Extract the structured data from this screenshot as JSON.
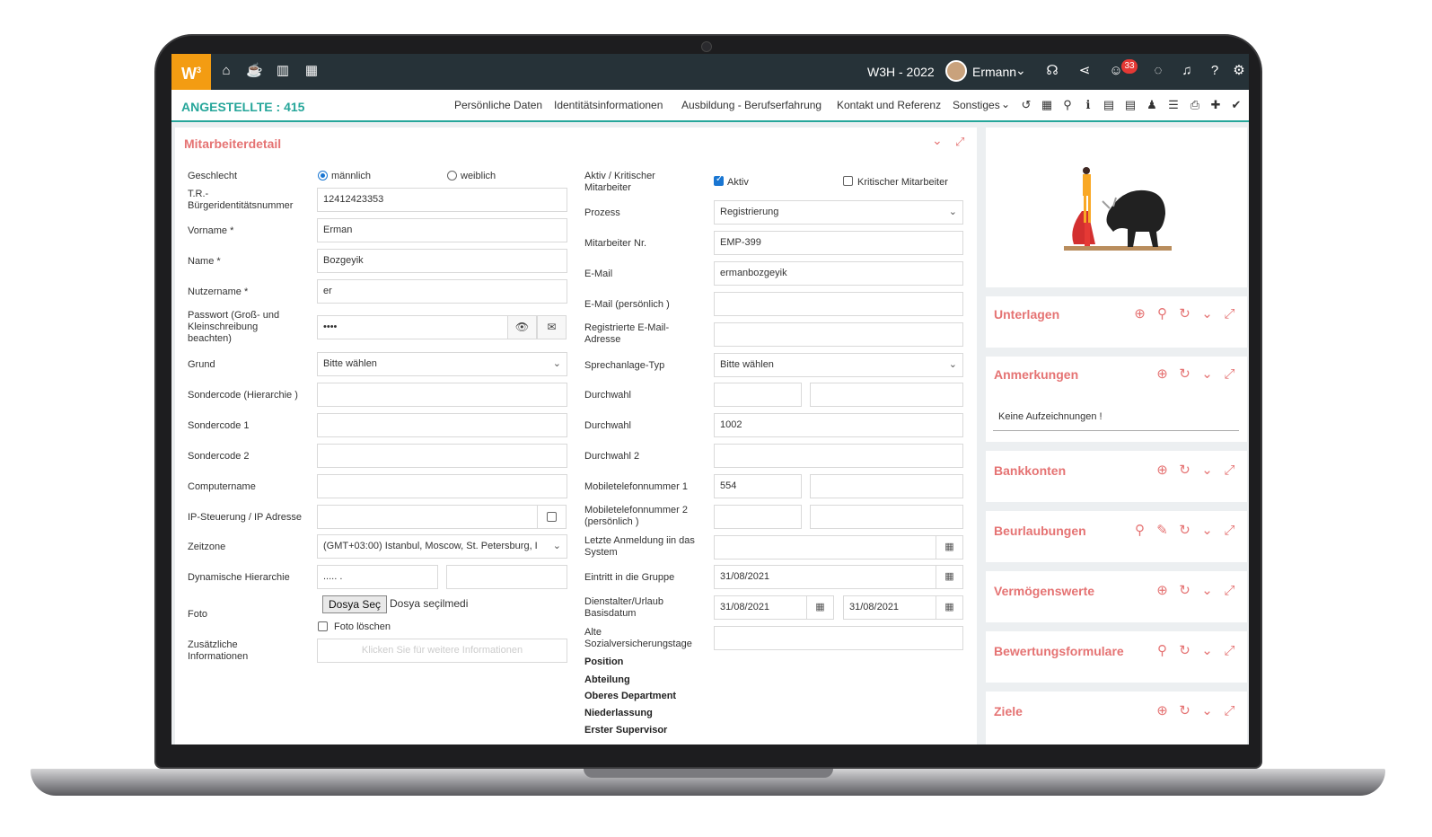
{
  "header": {
    "logo": "W",
    "logo_sup": "3",
    "nav_icons": [
      "home-icon",
      "coffee-icon",
      "bar-chart-icon",
      "calendar-icon"
    ],
    "company": "W3H - 2022",
    "user": "Ermann",
    "user_chevron": "⌄",
    "notification_count": "33",
    "right_icons": [
      "headset-icon",
      "share-icon",
      "smiley-icon",
      "chat-icon",
      "bell-icon",
      "help-icon",
      "gear-icon"
    ]
  },
  "subbar": {
    "title": "ANGESTELLTE : 415",
    "tabs": [
      "Persönliche Daten",
      "Identitätsinformationen",
      "Ausbildung - Berufserfahrung",
      "Kontakt und Referenz",
      "Sonstiges"
    ],
    "tool_icons": [
      "history-icon",
      "table-icon",
      "search-icon",
      "info-icon",
      "archive-icon",
      "archive-2-icon",
      "bell-icon",
      "list-icon",
      "print-icon",
      "plus-icon",
      "check-icon"
    ]
  },
  "detail": {
    "title": "Mitarbeiterdetail",
    "left": {
      "gender_label": "Geschlecht",
      "gender_male": "männlich",
      "gender_female": "weiblich",
      "tc_label": "T.R.-Bürgeridentitätsnummer",
      "tc_value": "12412423353",
      "firstname_label": "Vorname *",
      "firstname_value": "Erman",
      "name_label": "Name *",
      "name_value": "Bozgeyik",
      "username_label": "Nutzername *",
      "username_value": "er",
      "password_label": "Passwort (Groß- und Kleinschreibung beachten)",
      "password_value": "••••",
      "reason_label": "Grund",
      "reason_value": "Bitte wählen",
      "special_hier_label": "Sondercode (Hierarchie )",
      "special1_label": "Sondercode 1",
      "special2_label": "Sondercode 2",
      "computer_label": "Computername",
      "ip_label": "IP-Steuerung / IP Adresse",
      "timezone_label": "Zeitzone",
      "timezone_value": "(GMT+03:00) Istanbul, Moscow, St. Petersburg, I",
      "dynhier_label": "Dynamische Hierarchie",
      "dynhier_value": "..... .",
      "photo_label": "Foto",
      "file_button": "Dosya Seç",
      "file_status": "Dosya seçilmedi",
      "photo_delete": "Foto löschen",
      "extra_label": "Zusätzliche Informationen",
      "extra_placeholder": "Klicken Sie für weitere Informationen"
    },
    "right": {
      "active_label": "Aktiv / Kritischer Mitarbeiter",
      "active_text": "Aktiv",
      "critical_text": "Kritischer Mitarbeiter",
      "process_label": "Prozess",
      "process_value": "Registrierung",
      "empno_label": "Mitarbeiter Nr.",
      "empno_value": "EMP-399",
      "email_label": "E-Mail",
      "email_value": "ermanbozgeyik",
      "email_personal_label": "E-Mail (persönlich )",
      "reg_email_label": "Registrierte E-Mail-Adresse",
      "intercom_label": "Sprechanlage-Typ",
      "intercom_value": "Bitte wählen",
      "ext_label": "Durchwahl",
      "ext2_label": "Durchwahl",
      "ext2_value": "1002",
      "ext3_label": "Durchwahl 2",
      "mobile1_label": "Mobiletelefonnummer 1",
      "mobile1_value": "554",
      "mobile2_label": "Mobiletelefonnummer 2 (persönlich )",
      "lastlogin_label": "Letzte Anmeldung iin das System",
      "group_entry_label": "Eintritt in die Gruppe",
      "group_entry_value": "31/08/2021",
      "seniority_label": "Dienstalter/Urlaub Basisdatum",
      "seniority_value1": "31/08/2021",
      "seniority_value2": "31/08/2021",
      "old_ss_label": "Alte Sozialversicherungstage",
      "position_label": "Position",
      "department_label": "Abteilung",
      "upper_dept_label": "Oberes Department",
      "branch_label": "Niederlassung",
      "first_supervisor_label": "Erster Supervisor"
    }
  },
  "sidebar": {
    "panels": [
      {
        "title": "Unterlagen",
        "icons": [
          "plus-circle-icon",
          "search-icon",
          "refresh-icon",
          "chevron-down-icon",
          "expand-icon"
        ]
      },
      {
        "title": "Anmerkungen",
        "icons": [
          "plus-circle-icon",
          "refresh-icon",
          "chevron-down-icon",
          "expand-icon"
        ],
        "note": "Keine Aufzeichnungen !"
      },
      {
        "title": "Bankkonten",
        "icons": [
          "plus-circle-icon",
          "refresh-icon",
          "chevron-down-icon",
          "expand-icon"
        ]
      },
      {
        "title": "Beurlaubungen",
        "icons": [
          "search-icon",
          "edit-icon",
          "refresh-icon",
          "chevron-down-icon",
          "expand-icon"
        ]
      },
      {
        "title": "Vermögenswerte",
        "icons": [
          "plus-circle-icon",
          "refresh-icon",
          "chevron-down-icon",
          "expand-icon"
        ]
      },
      {
        "title": "Bewertungsformulare",
        "icons": [
          "search-icon",
          "refresh-icon",
          "chevron-down-icon",
          "expand-icon"
        ]
      },
      {
        "title": "Ziele",
        "icons": [
          "plus-circle-icon",
          "refresh-icon",
          "chevron-down-icon",
          "expand-icon"
        ]
      }
    ]
  },
  "colors": {
    "topbar": "#263238",
    "logo": "#f39c12",
    "accent": "#26a69a",
    "panel_title": "#e57373"
  }
}
